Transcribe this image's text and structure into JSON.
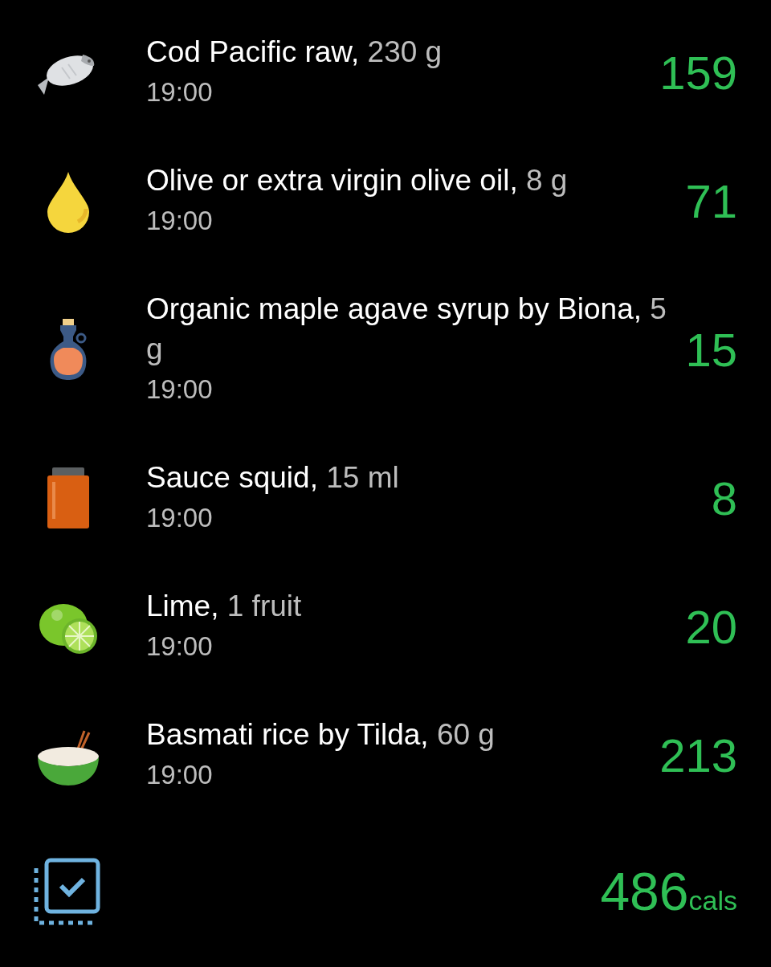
{
  "entries": [
    {
      "kind": "fish",
      "name": "Cod Pacific raw,",
      "amount": "230 g",
      "time": "19:00",
      "calories": "159"
    },
    {
      "kind": "oil",
      "name": "Olive or extra virgin olive oil,",
      "amount": "8 g",
      "time": "19:00",
      "calories": "71"
    },
    {
      "kind": "syrup",
      "name": "Organic maple agave syrup by Biona,",
      "amount": "5 g",
      "time": "19:00",
      "calories": "15"
    },
    {
      "kind": "jar",
      "name": "Sauce squid,",
      "amount": "15 ml",
      "time": "19:00",
      "calories": "8"
    },
    {
      "kind": "lime",
      "name": "Lime,",
      "amount": "1 fruit",
      "time": "19:00",
      "calories": "20"
    },
    {
      "kind": "rice",
      "name": "Basmati rice by Tilda,",
      "amount": "60 g",
      "time": "19:00",
      "calories": "213"
    }
  ],
  "total": {
    "value": "486",
    "unit": "cals"
  }
}
